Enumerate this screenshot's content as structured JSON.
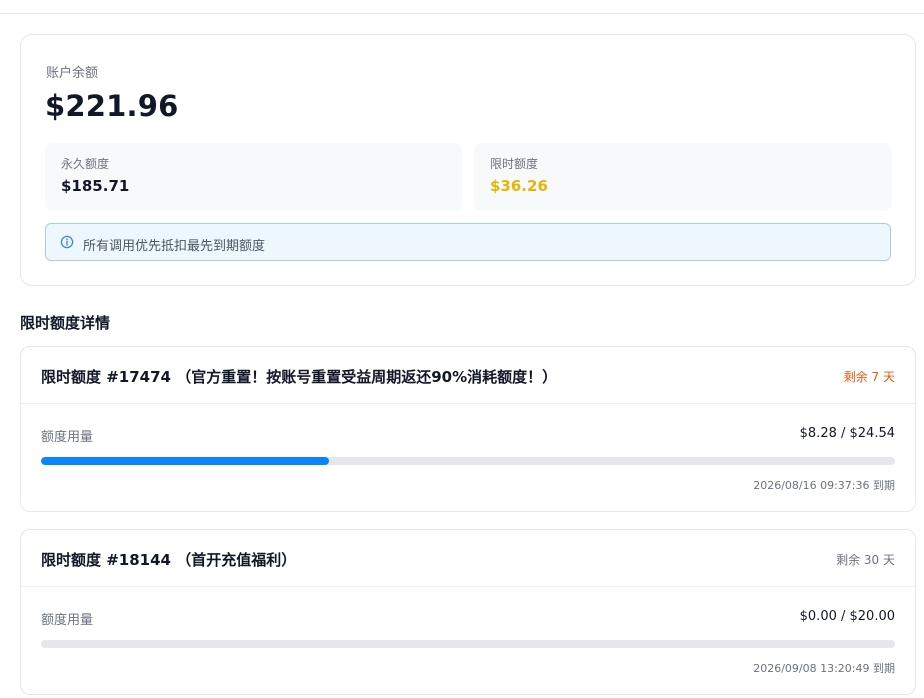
{
  "balance": {
    "label": "账户余额",
    "total": "$221.96",
    "permanent": {
      "label": "永久额度",
      "value": "$185.71"
    },
    "limited": {
      "label": "限时额度",
      "value": "$36.26"
    },
    "notice": "所有调用优先抵扣最先到期额度"
  },
  "grants_section": {
    "title": "限时额度详情",
    "items": [
      {
        "title": "限时额度 #17474 （官方重置！按账号重置受益周期返还90%消耗额度！）",
        "remaining": "剩余 7 天",
        "usage_label": "额度用量",
        "usage": "$8.28 / $24.54",
        "used": 8.28,
        "limit": 24.54,
        "expiry": "2026/08/16 09:37:36 到期"
      },
      {
        "title": "限时额度 #18144 （首开充值福利）",
        "remaining": "剩余 30 天",
        "usage_label": "额度用量",
        "usage": "$0.00 / $20.00",
        "used": 0,
        "limit": 20,
        "expiry": "2026/09/08 13:20:49 到期"
      }
    ]
  },
  "colors": {
    "accent": "#0a84ff",
    "limited_value": "#eab308",
    "expiring_soon": "#ea580c"
  },
  "icons": {
    "notice": "info-icon"
  }
}
